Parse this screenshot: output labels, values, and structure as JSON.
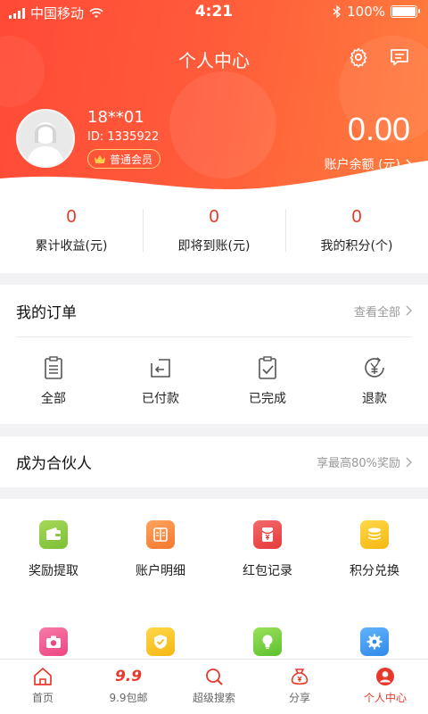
{
  "status_bar": {
    "carrier": "中国移动",
    "time": "4:21",
    "battery": "100%"
  },
  "header": {
    "title": "个人中心"
  },
  "profile": {
    "name": "18**01",
    "id": "ID: 1335922",
    "level": "普通会员"
  },
  "balance": {
    "amount": "0.00",
    "label": "账户余额 (元)"
  },
  "stats": [
    {
      "value": "0",
      "label": "累计收益(元)"
    },
    {
      "value": "0",
      "label": "即将到账(元)"
    },
    {
      "value": "0",
      "label": "我的积分(个)"
    }
  ],
  "orders": {
    "title": "我的订单",
    "more": "查看全部",
    "items": [
      {
        "label": "全部",
        "icon": "clipboard-icon"
      },
      {
        "label": "已付款",
        "icon": "return-icon"
      },
      {
        "label": "已完成",
        "icon": "check-clipboard-icon"
      },
      {
        "label": "退款",
        "icon": "yuan-refund-icon"
      }
    ]
  },
  "partner": {
    "title": "成为合伙人",
    "more": "享最高80%奖励"
  },
  "services": [
    {
      "label": "奖励提取",
      "icon": "wallet-icon",
      "color": "#8cc63f"
    },
    {
      "label": "账户明细",
      "icon": "ledger-icon",
      "color": "#f7843c"
    },
    {
      "label": "红包记录",
      "icon": "red-packet-icon",
      "color": "#ee4d4d"
    },
    {
      "label": "积分兑换",
      "icon": "coins-icon",
      "color": "#f7c325"
    },
    {
      "label": "",
      "icon": "camera-icon",
      "color": "#f0528c"
    },
    {
      "label": "",
      "icon": "shield-check-icon",
      "color": "#f7c325"
    },
    {
      "label": "",
      "icon": "lightbulb-icon",
      "color": "#7ad043"
    },
    {
      "label": "",
      "icon": "gear-icon",
      "color": "#3b9bf0"
    }
  ],
  "tabs": [
    {
      "label": "首页",
      "icon": "home-icon"
    },
    {
      "label": "9.9包邮",
      "icon": "9.9",
      "mark": "9.9"
    },
    {
      "label": "超级搜索",
      "icon": "search-icon"
    },
    {
      "label": "分享",
      "icon": "share-bag-icon"
    },
    {
      "label": "个人中心",
      "icon": "person-icon",
      "active": true
    }
  ],
  "colors": {
    "accent": "#e8382b",
    "header_start": "#ff4a36",
    "header_end": "#ff7d3d"
  }
}
